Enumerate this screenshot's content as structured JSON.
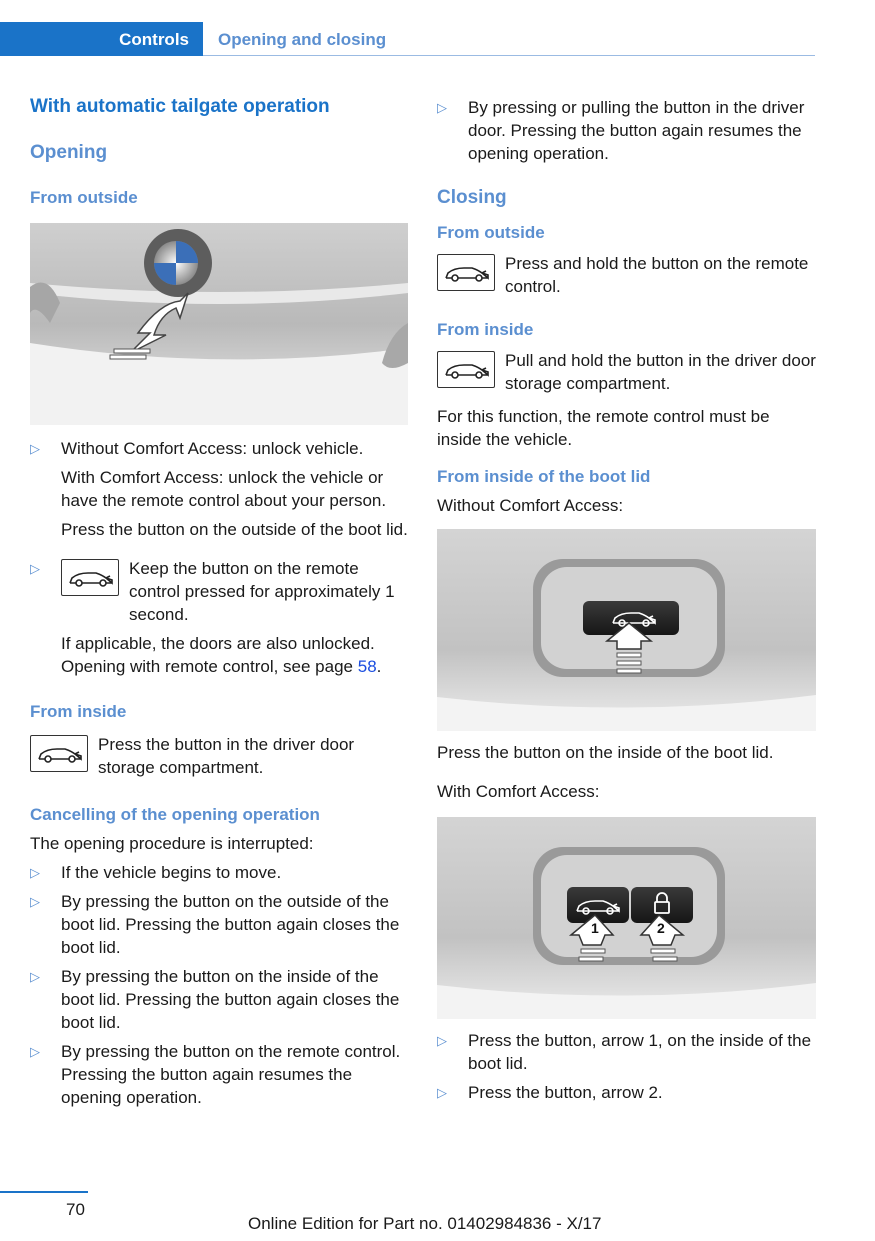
{
  "header": {
    "section": "Controls",
    "chapter": "Opening and closing"
  },
  "left": {
    "title": "With automatic tailgate operation",
    "opening": "Opening",
    "from_outside": "From outside",
    "b1_line1": "Without Comfort Access: unlock vehicle.",
    "b1_line2": "With Comfort Access: unlock the vehicle or have the remote control about your person.",
    "b1_line3": "Press the button on the outside of the boot lid.",
    "b2_text": "Keep the button on the remote control pressed for approximately 1 second.",
    "b2_cont_pre": "If applicable, the doors are also unlocked. Opening with remote control, see page ",
    "b2_link": "58",
    "b2_cont_post": ".",
    "from_inside": "From inside",
    "inside_text": "Press the button in the driver door storage compartment.",
    "cancel_title": "Cancelling of the opening operation",
    "cancel_intro": "The opening procedure is interrupted:",
    "cancel_items": [
      "If the vehicle begins to move.",
      "By pressing the button on the outside of the boot lid. Pressing the button again closes the boot lid.",
      "By pressing the button on the inside of the boot lid. Pressing the button again closes the boot lid.",
      "By pressing the button on the remote control. Pressing the button again resumes the opening operation."
    ]
  },
  "right": {
    "b_top": "By pressing or pulling the button in the driver door. Pressing the button again resumes the opening operation.",
    "closing": "Closing",
    "from_outside": "From outside",
    "outside_text": "Press and hold the button on the remote control.",
    "from_inside": "From inside",
    "inside_text": "Pull and hold the button in the driver door storage compartment.",
    "remote_note": "For this function, the remote control must be inside the vehicle.",
    "bootlid_title": "From inside of the boot lid",
    "without_ca": "Without Comfort Access:",
    "press_inside": "Press the button on the inside of the boot lid.",
    "with_ca": "With Comfort Access:",
    "arrow1": "1",
    "arrow2": "2",
    "final_items": [
      "Press the button, arrow 1, on the inside of the boot lid.",
      "Press the button, arrow 2."
    ]
  },
  "footer": {
    "page": "70",
    "edition": "Online Edition for Part no. 01402984836 - X/17"
  },
  "bullet_glyph": "▷",
  "icons": [
    "car-tailgate-icon",
    "bmw-logo-icon",
    "lock-icon",
    "arrow-icon"
  ]
}
